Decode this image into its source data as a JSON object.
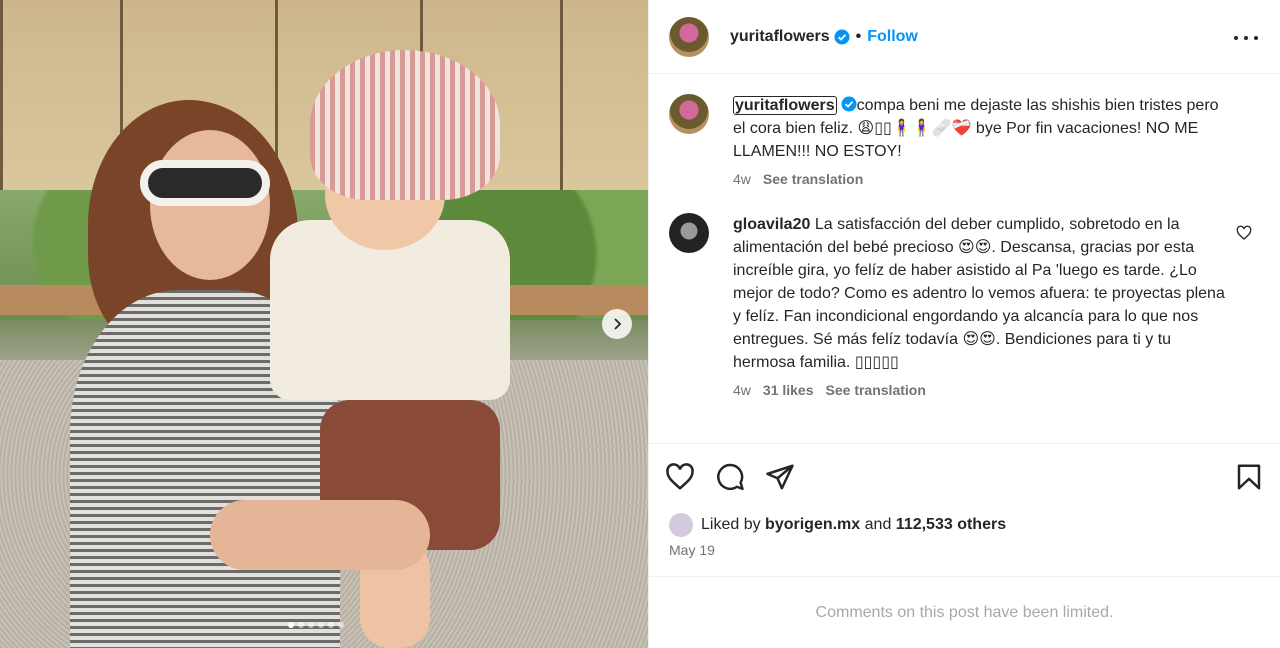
{
  "post": {
    "author": "yuritaflowers",
    "separator": "•",
    "follow_label": "Follow"
  },
  "caption": {
    "user": "yuritaflowers",
    "text": "compa beni me dejaste las shishis bien tristes pero el cora bien feliz. 😩▯▯🧍‍♀️🧍‍♀️🩹❤️‍🩹 bye Por fin vacaciones! NO ME LLAMEN!!! NO ESTOY!",
    "age": "4w",
    "translate_label": "See translation"
  },
  "comments": [
    {
      "user": "gloavila20",
      "text": "La satisfacción del deber cumplido, sobretodo en la alimentación del bebé precioso 😍😍. Descansa, gracias por esta increíble gira, yo felíz de haber asistido al Pa 'luego es tarde. ¿Lo mejor de todo? Como es adentro lo vemos afuera: te proyectas plena y felíz. Fan incondicional engordando ya alcancía para lo que nos entregues. Sé más felíz todavía 😍😍. Bendiciones para ti y tu hermosa familia. ▯▯▯▯▯",
      "age": "4w",
      "likes": "31 likes",
      "translate_label": "See translation"
    }
  ],
  "likes": {
    "prefix": "Liked by",
    "user": "byorigen.mx",
    "and": "and",
    "others": "112,533 others"
  },
  "date": "May 19",
  "comments_limited": "Comments on this post have been limited.",
  "carousel": {
    "count": 6,
    "active_index": 0
  },
  "icons": [
    "verified-badge-icon",
    "more-options-icon",
    "heart-icon",
    "comment-icon",
    "share-icon",
    "bookmark-icon",
    "chevron-right-icon"
  ],
  "colors": {
    "accent": "#0095f6",
    "text": "#262626",
    "muted": "#737373",
    "limited_text": "#a8a8a8"
  }
}
